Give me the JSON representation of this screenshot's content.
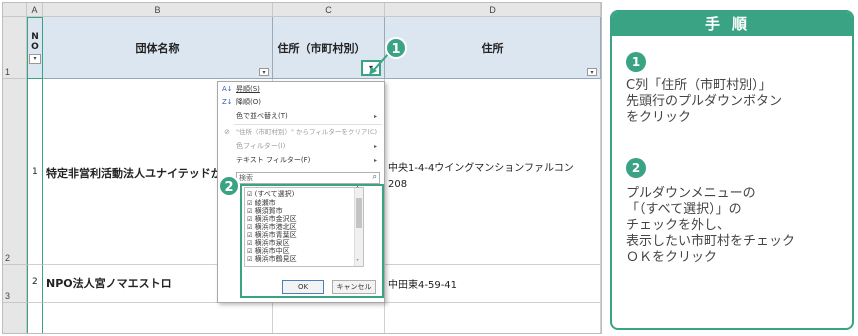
{
  "sheet": {
    "col_headers": [
      "A",
      "B",
      "C",
      "D"
    ],
    "row_numbers": [
      "1",
      "2",
      "3"
    ],
    "header_row": {
      "no": "NO",
      "dantai": "団体名称",
      "jusho_shichoson": "住所（市町村別）",
      "jusho": "住所"
    },
    "rows": [
      {
        "no": "1",
        "name": "特定非営利活動法人ユナイテッドか",
        "address_line1": "中央1-4-4ウイングマンションファルコン",
        "address_line2": "208"
      },
      {
        "no": "2",
        "name": "NPO法人宮ノマエストロ",
        "address": "中田東4-59-41"
      }
    ]
  },
  "filter_menu": {
    "items": [
      {
        "icon": "A↓",
        "label": "昇順(S)"
      },
      {
        "icon": "Z↓",
        "label": "降順(O)"
      },
      {
        "icon": "",
        "label": "色で並べ替え(T)"
      },
      {
        "icon": "⊘",
        "label": "\"住所（市町村別）\" からフィルターをクリア(C)"
      },
      {
        "icon": "",
        "label": "色フィルター(I)"
      },
      {
        "icon": "",
        "label": "テキスト フィルター(F)"
      }
    ],
    "search_placeholder": "検索",
    "checklist": [
      "(すべて選択)",
      "綾瀬市",
      "横須賀市",
      "横浜市金沢区",
      "横浜市港北区",
      "横浜市青葉区",
      "横浜市泉区",
      "横浜市中区",
      "横浜市鶴見区"
    ],
    "ok_label": "OK",
    "cancel_label": "キャンセル"
  },
  "badges": {
    "one": "1",
    "two": "2"
  },
  "panel": {
    "title": "手順",
    "step1_num": "1",
    "step1_text": "C列「住所（市町村別）」\n先頭行のプルダウンボタン\nをクリック",
    "step2_num": "2",
    "step2_text": "プルダウンメニューの\n「（すべて選択）」の\nチェックを外し、\n表示したい市町村をチェック\nＯＫをクリック"
  },
  "colors": {
    "accent": "#3aa384",
    "header_fill": "#dce6f1"
  }
}
